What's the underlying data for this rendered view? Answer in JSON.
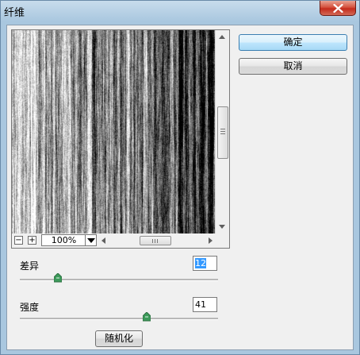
{
  "window": {
    "title": "纤维"
  },
  "buttons": {
    "ok_label": "确定",
    "cancel_label": "取消",
    "randomize_label": "随机化"
  },
  "preview": {
    "zoom_level": "100%",
    "zoom_out_symbol": "−",
    "zoom_in_symbol": "+"
  },
  "params": {
    "variance": {
      "label": "差异",
      "value": "12",
      "fraction": 0.19
    },
    "strength": {
      "label": "强度",
      "value": "41",
      "fraction": 0.64
    }
  },
  "icons": {
    "close": "close-icon",
    "dropdown": "chevron-down-icon"
  },
  "colors": {
    "titlebar": "#a9c7df",
    "close_button": "#c42b1c",
    "primary_border": "#3c7fb1",
    "selection": "#3399ff"
  }
}
